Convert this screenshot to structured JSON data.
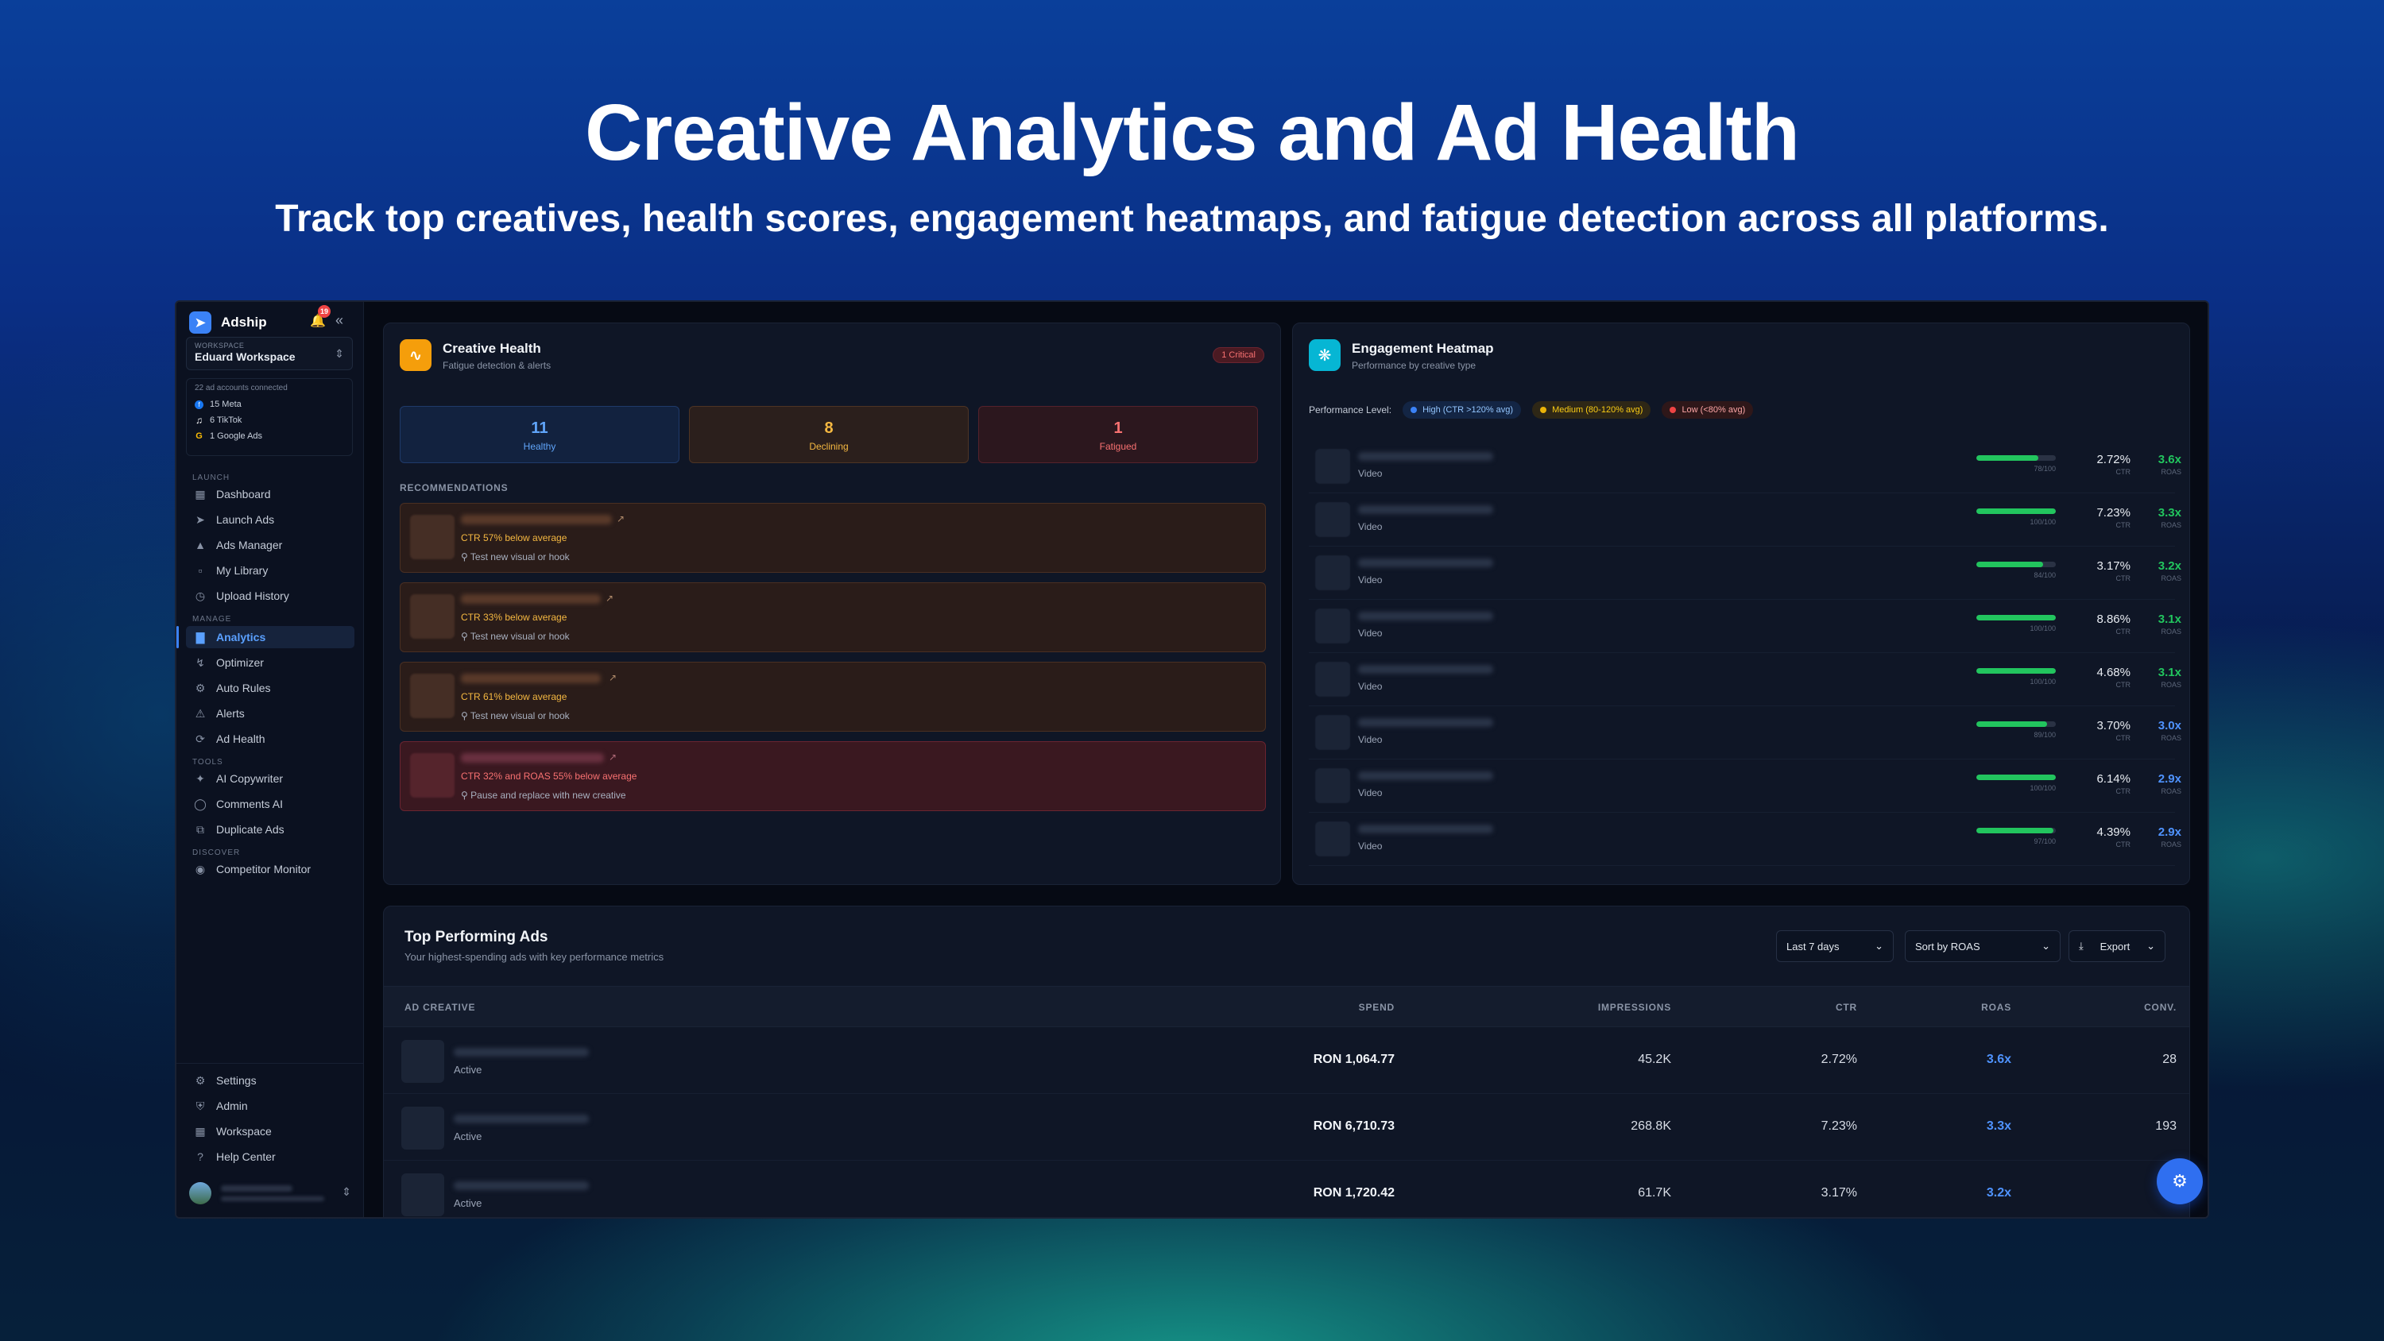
{
  "hero": {
    "title": "Creative Analytics and Ad Health",
    "subtitle": "Track top creatives, health scores, engagement heatmaps, and fatigue detection across all platforms."
  },
  "sidebar": {
    "brand": "Adship",
    "notification_count": "19",
    "workspace_label": "WORKSPACE",
    "workspace_name": "Eduard Workspace",
    "accounts_title": "22 ad accounts connected",
    "accounts": [
      {
        "label": "15 Meta",
        "icon": "meta-icon",
        "color": "#1877f2"
      },
      {
        "label": "6 TikTok",
        "icon": "tiktok-icon",
        "color": "#ffffff"
      },
      {
        "label": "1 Google Ads",
        "icon": "google-icon",
        "color": "#fbbc05"
      }
    ],
    "sections": {
      "launch": "LAUNCH",
      "manage": "MANAGE",
      "tools": "TOOLS",
      "discover": "DISCOVER"
    },
    "items": {
      "dashboard": "Dashboard",
      "launch_ads": "Launch Ads",
      "ads_manager": "Ads Manager",
      "my_library": "My Library",
      "upload_history": "Upload History",
      "analytics": "Analytics",
      "optimizer": "Optimizer",
      "auto_rules": "Auto Rules",
      "alerts": "Alerts",
      "ad_health": "Ad Health",
      "ai_copywriter": "AI Copywriter",
      "comments_ai": "Comments AI",
      "duplicate_ads": "Duplicate Ads",
      "competitor_monitor": "Competitor Monitor",
      "settings": "Settings",
      "admin": "Admin",
      "workspace": "Workspace",
      "help_center": "Help Center"
    }
  },
  "creative_health": {
    "title": "Creative Health",
    "subtitle": "Fatigue detection & alerts",
    "badge": "1 Critical",
    "stats": [
      {
        "value": "11",
        "label": "Healthy"
      },
      {
        "value": "8",
        "label": "Declining"
      },
      {
        "value": "1",
        "label": "Fatigued"
      }
    ],
    "recommendations_heading": "RECOMMENDATIONS",
    "recommendations": [
      {
        "message": "CTR 57% below average",
        "tip": "Test new visual or hook",
        "severity": "warning"
      },
      {
        "message": "CTR 33% below average",
        "tip": "Test new visual or hook",
        "severity": "warning"
      },
      {
        "message": "CTR 61% below average",
        "tip": "Test new visual or hook",
        "severity": "warning"
      },
      {
        "message": "CTR 32% and ROAS 55% below average",
        "tip": "Pause and replace with new creative",
        "severity": "critical"
      }
    ]
  },
  "heatmap": {
    "title": "Engagement Heatmap",
    "subtitle": "Performance by creative type",
    "level_label": "Performance Level:",
    "levels": [
      {
        "label": "High (CTR >120% avg)",
        "color": "#3b82f6"
      },
      {
        "label": "Medium (80-120% avg)",
        "color": "#eab308"
      },
      {
        "label": "Low (<80% avg)",
        "color": "#ef4444"
      }
    ],
    "ctr_label": "CTR",
    "roas_label": "ROAS",
    "rows": [
      {
        "type": "Video",
        "score": 78,
        "score_text": "78/100",
        "ctr": "2.72%",
        "roas": "3.6x",
        "roas_color": "#22c55e"
      },
      {
        "type": "Video",
        "score": 100,
        "score_text": "100/100",
        "ctr": "7.23%",
        "roas": "3.3x",
        "roas_color": "#22c55e"
      },
      {
        "type": "Video",
        "score": 84,
        "score_text": "84/100",
        "ctr": "3.17%",
        "roas": "3.2x",
        "roas_color": "#22c55e"
      },
      {
        "type": "Video",
        "score": 100,
        "score_text": "100/100",
        "ctr": "8.86%",
        "roas": "3.1x",
        "roas_color": "#22c55e"
      },
      {
        "type": "Video",
        "score": 100,
        "score_text": "100/100",
        "ctr": "4.68%",
        "roas": "3.1x",
        "roas_color": "#22c55e"
      },
      {
        "type": "Video",
        "score": 89,
        "score_text": "89/100",
        "ctr": "3.70%",
        "roas": "3.0x",
        "roas_color": "#4f93ff"
      },
      {
        "type": "Video",
        "score": 100,
        "score_text": "100/100",
        "ctr": "6.14%",
        "roas": "2.9x",
        "roas_color": "#4f93ff"
      },
      {
        "type": "Video",
        "score": 97,
        "score_text": "97/100",
        "ctr": "4.39%",
        "roas": "2.9x",
        "roas_color": "#4f93ff"
      }
    ]
  },
  "top_ads": {
    "title": "Top Performing Ads",
    "subtitle": "Your highest-spending ads with key performance metrics",
    "period": "Last 7 days",
    "sort": "Sort by ROAS",
    "export": "Export",
    "columns": [
      "AD CREATIVE",
      "SPEND",
      "IMPRESSIONS",
      "CTR",
      "ROAS",
      "CONV."
    ],
    "rows": [
      {
        "status": "Active",
        "spend": "RON 1,064.77",
        "impressions": "45.2K",
        "ctr": "2.72%",
        "roas": "3.6x",
        "conv": "28"
      },
      {
        "status": "Active",
        "spend": "RON 6,710.73",
        "impressions": "268.8K",
        "ctr": "7.23%",
        "roas": "3.3x",
        "conv": "193"
      },
      {
        "status": "Active",
        "spend": "RON 1,720.42",
        "impressions": "61.7K",
        "ctr": "3.17%",
        "roas": "3.2x",
        "conv": ""
      }
    ]
  }
}
